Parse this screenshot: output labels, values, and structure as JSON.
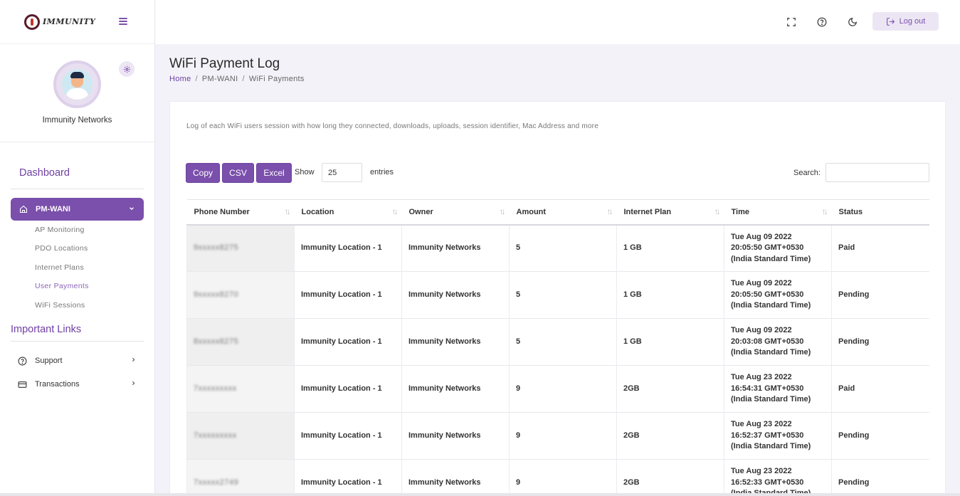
{
  "brand": {
    "logo_text": "IMMUNITY"
  },
  "profile": {
    "name": "Immunity Networks"
  },
  "sidebar": {
    "dashboard": "Dashboard",
    "active_section": "PM-WANI",
    "sub_items": [
      "AP Monitoring",
      "PDO Locations",
      "Internet Plans",
      "User Payments",
      "WiFi Sessions"
    ],
    "important_links": "Important Links",
    "links": [
      {
        "label": "Support",
        "icon": "help-circle-icon"
      },
      {
        "label": "Transactions",
        "icon": "card-icon"
      }
    ]
  },
  "topbar": {
    "logout_label": "Log out"
  },
  "page": {
    "title": "WiFi Payment Log",
    "breadcrumb": [
      "Home",
      "PM-WANI",
      "WiFi Payments"
    ],
    "description": "Log of each WiFi users session with how long they connected, downloads, uploads, session identifier, Mac Address and more"
  },
  "controls": {
    "copy": "Copy",
    "csv": "CSV",
    "excel": "Excel",
    "show": "Show",
    "entries_value": "25",
    "entries": "entries",
    "search": "Search:"
  },
  "table": {
    "columns": [
      "Phone Number",
      "Location",
      "Owner",
      "Amount",
      "Internet Plan",
      "Time",
      "Status"
    ],
    "rows": [
      {
        "phone": "9xxxxx8275",
        "location": "Immunity Location - 1",
        "owner": "Immunity Networks",
        "amount": "5",
        "plan": "1 GB",
        "time": [
          "Tue Aug 09 2022",
          "20:05:50 GMT+0530",
          "(India Standard Time)"
        ],
        "status": "Paid"
      },
      {
        "phone": "9xxxxx8270",
        "location": "Immunity Location - 1",
        "owner": "Immunity Networks",
        "amount": "5",
        "plan": "1 GB",
        "time": [
          "Tue Aug 09 2022",
          "20:05:50 GMT+0530",
          "(India Standard Time)"
        ],
        "status": "Pending"
      },
      {
        "phone": "8xxxxx8275",
        "location": "Immunity Location - 1",
        "owner": "Immunity Networks",
        "amount": "5",
        "plan": "1 GB",
        "time": [
          "Tue Aug 09 2022",
          "20:03:08 GMT+0530",
          "(India Standard Time)"
        ],
        "status": "Pending"
      },
      {
        "phone": "7xxxxxxxxx",
        "location": "Immunity Location - 1",
        "owner": "Immunity Networks",
        "amount": "9",
        "plan": "2GB",
        "time": [
          "Tue Aug 23 2022",
          "16:54:31 GMT+0530",
          "(India Standard Time)"
        ],
        "status": "Paid"
      },
      {
        "phone": "7xxxxxxxxx",
        "location": "Immunity Location - 1",
        "owner": "Immunity Networks",
        "amount": "9",
        "plan": "2GB",
        "time": [
          "Tue Aug 23 2022",
          "16:52:37 GMT+0530",
          "(India Standard Time)"
        ],
        "status": "Pending"
      },
      {
        "phone": "7xxxxx2749",
        "location": "Immunity Location - 1",
        "owner": "Immunity Networks",
        "amount": "9",
        "plan": "2GB",
        "time": [
          "Tue Aug 23 2022",
          "16:52:33 GMT+0530",
          "(India Standard Time)"
        ],
        "status": "Pending"
      }
    ]
  },
  "colors": {
    "accent": "#7b4fac",
    "accent_light": "#ece6f4",
    "heading": "#6e3fa3"
  }
}
